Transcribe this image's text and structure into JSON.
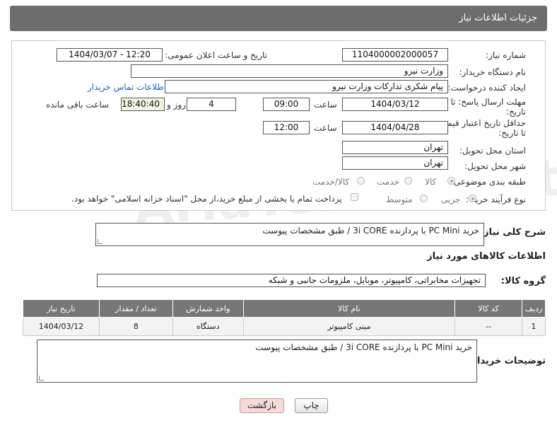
{
  "header": {
    "title": "جزئیات اطلاعات نیاز"
  },
  "form": {
    "need_number_label": "شماره نیاز:",
    "need_number": "1104000002000057",
    "announce_label": "تاریخ و ساعت اعلان عمومی:",
    "announce_value": "1404/03/07 - 12:20",
    "buyer_label": "نام دستگاه خریدار:",
    "buyer_value": "وزارت نیرو",
    "creator_label": "ایجاد کننده درخواست:",
    "creator_value": "پیام شکری تدارکات وزارت نیرو",
    "contact_link": "اطلاعات تماس خریدار",
    "deadline_label_1": "مهلت ارسال پاسخ: تا",
    "deadline_label_2": "تاریخ:",
    "deadline_date": "1404/03/12",
    "time_label": "ساعت",
    "deadline_time": "09:00",
    "days_value": "4",
    "days_label": "روز و",
    "remaining_value": "18:40:40",
    "remaining_label": "ساعت باقی مانده",
    "price_label_1": "حداقل تاریخ اعتبار قیمت:",
    "price_label_2": "تا تاریخ:",
    "price_date": "1404/04/28",
    "price_time_label": "ساعت",
    "price_time": "12:00",
    "province_label": "استان محل تحویل:",
    "province_value": "تهران",
    "city_label": "شهر محل تحویل:",
    "city_value": "تهران",
    "category_label": "طبقه بندی موضوعی:",
    "category_options": [
      "کالا",
      "خدمت",
      "کالا/خدمت"
    ],
    "process_label": "نوع فرآیند خرید :",
    "process_options": [
      "جزیی",
      "متوسط"
    ],
    "payment_note": "پرداخت تمام یا بخشی از مبلغ خرید،از محل \"اسناد خزانه اسلامی\" خواهد بود."
  },
  "description": {
    "label": "شرح کلی نیاز:",
    "value": "خرید PC Mini با پردازنده 3i CORE / طبق مشخصات پیوست"
  },
  "goods": {
    "section_title": "اطلاعات کالاهای مورد نیاز",
    "group_label": "گروه کالا:",
    "group_value": "تجهیزات مخابراتی، کامپیوتر، موبایل، ملزومات جانبی و شبکه",
    "columns": [
      "ردیف",
      "کد کالا",
      "نام کالا",
      "واحد شمارش",
      "تعداد / مقدار",
      "تاریخ نیاز"
    ],
    "rows": [
      [
        "1",
        "--",
        "مینی کامپیوتر",
        "دستگاه",
        "8",
        "1404/03/12"
      ]
    ]
  },
  "buyer_notes": {
    "label": "توضیحات خریدار:",
    "value": "خرید PC Mini با پردازنده 3i CORE / طبق مشخصات پیوست"
  },
  "buttons": {
    "print": "چاپ",
    "back": "بازگشت"
  },
  "watermark": "AriaTender.net"
}
